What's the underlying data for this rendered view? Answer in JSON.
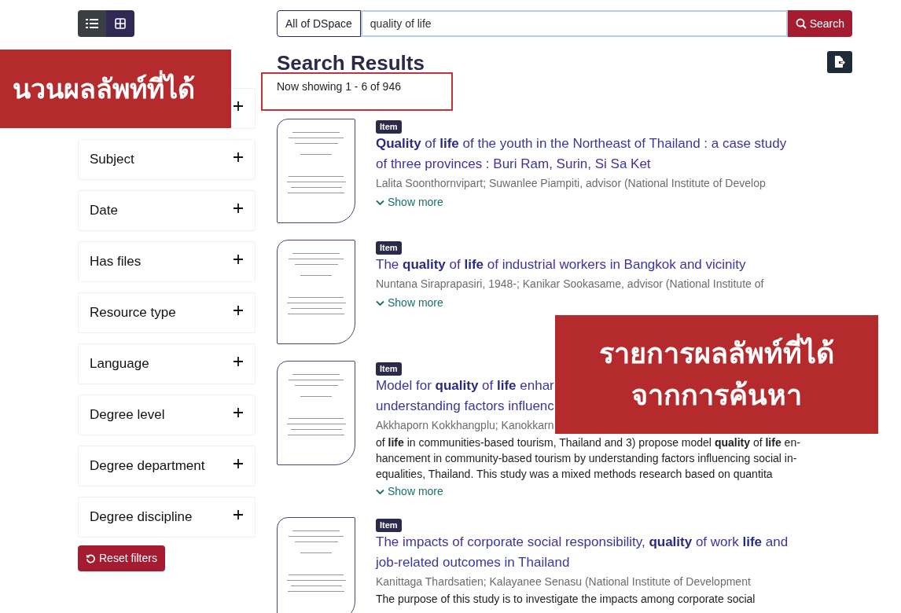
{
  "view_toggle": [
    {
      "kind": "list",
      "selected": true
    },
    {
      "kind": "grid",
      "selected": false
    }
  ],
  "search": {
    "scope": "All of DSpace",
    "query": "quality of life",
    "button": "Search"
  },
  "heading": "Search Results",
  "result_count": "Now showing 1 - 6 of 946",
  "filters": [
    {
      "expanded": false
    },
    {
      "title": "Subject",
      "expanded": false
    },
    {
      "title": "Date",
      "expanded": false
    },
    {
      "title": "Has files",
      "expanded": false
    },
    {
      "title": "Resource type",
      "expanded": false
    },
    {
      "title": "Language",
      "expanded": false
    },
    {
      "title": "Degree level",
      "expanded": false
    },
    {
      "title": "Degree department",
      "expanded": false
    },
    {
      "title": "Degree discipline",
      "expanded": false
    }
  ],
  "reset_button": "Reset filters",
  "results": [
    {
      "badge": "Item",
      "title_lines": [
        "**Quality** of **life** of the youth in the Northeast of Thailand : a case study",
        "of three provinces : Buri Ram, Surin, Si Sa Ket"
      ],
      "authors": "Lalita Soonthornvipart; Suwanlee Piampiti, advisor (National Institute of Develop",
      "show_more": "Show more"
    },
    {
      "badge": "Item",
      "title_lines": [
        "The **quality** of **life** of industrial workers in Bangkok and vicinity"
      ],
      "authors": "Nuntana Siraprapasiri, 1948-; Kanikar Sookasame, advisor (National Institute of",
      "show_more": "Show more"
    },
    {
      "badge": "Item",
      "title_lines": [
        "Model for **quality** of **life** enhar",
        "understanding factors influenc"
      ],
      "authors": "Akkhaporn Kokkhangplu; Kanokkarn",
      "abstract_lines": [
        "of **life** in communities-based tourism, Thailand and 3) propose model **quality** of **life** en-",
        "hancement in community-based tourism by understanding factors influencing social in-",
        "equalities, Thailand.  This study was a mixed methods research based on quantita"
      ],
      "show_more": "Show more"
    },
    {
      "badge": "Item",
      "title_lines": [
        "The impacts of corporate social responsibility, **quality** of work **life** and",
        "job-related outcomes in Thailand"
      ],
      "authors": "Kanittaga Thardsatien; Kalayanee Senasu (National Institute of Development",
      "abstract_lines": [
        "The purpose of this study is to investigate the impacts among corporate social"
      ]
    }
  ],
  "annotations": [
    {
      "kind": "highlight"
    },
    {
      "kind": "banner",
      "text_lines": [
        "นวนผลลัพท์ที่ได้"
      ]
    },
    {
      "kind": "banner",
      "text_lines": [
        "รายการผลลัพท์ที่ได้",
        "จากการค้นหา"
      ]
    }
  ]
}
